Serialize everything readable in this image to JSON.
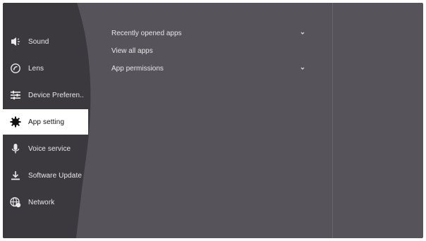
{
  "sidebar": {
    "items": [
      {
        "label": "Sound",
        "icon": "speaker-icon"
      },
      {
        "label": "Lens",
        "icon": "lens-icon"
      },
      {
        "label": "Device Preferen..",
        "icon": "sliders-icon"
      },
      {
        "label": "App setting",
        "icon": "gear-icon",
        "active": true
      },
      {
        "label": "Voice service",
        "icon": "microphone-icon"
      },
      {
        "label": "Software Update",
        "icon": "download-icon"
      },
      {
        "label": "Network",
        "icon": "globe-icon"
      }
    ]
  },
  "main": {
    "items": [
      {
        "label": "Recently opened apps",
        "expandable": true
      },
      {
        "label": "View all apps",
        "expandable": false
      },
      {
        "label": "App permissions",
        "expandable": true
      }
    ]
  },
  "colors": {
    "background": "#57535a",
    "sidebar": "#3d3a40",
    "active_item": "#ffffff",
    "text": "#e9e9ea"
  }
}
